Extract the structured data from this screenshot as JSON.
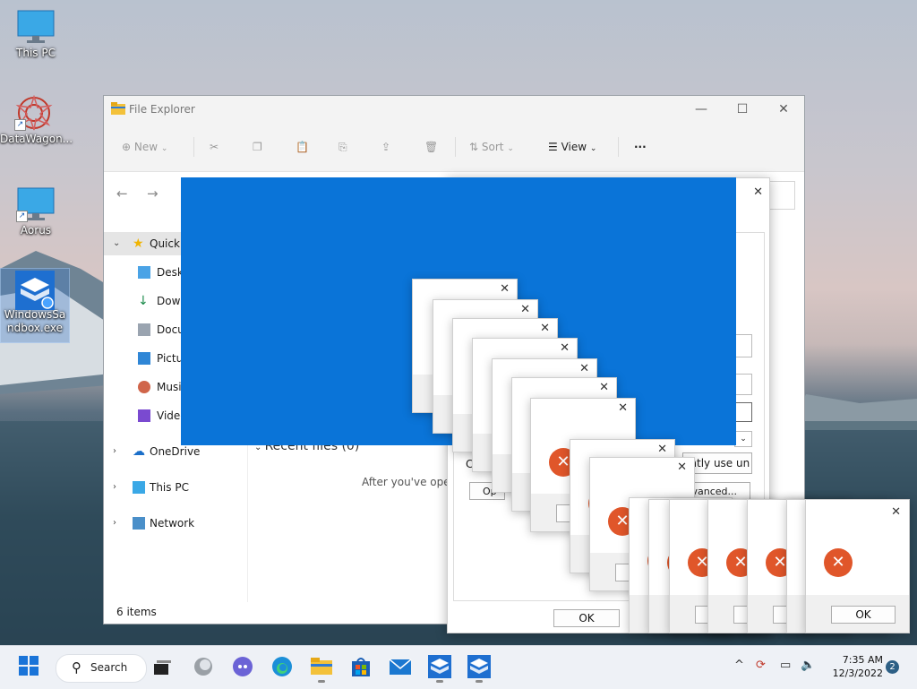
{
  "desktop": {
    "icons": [
      {
        "label": "This PC"
      },
      {
        "label": "DataWagon..."
      },
      {
        "label": "Aorus"
      },
      {
        "label": "WindowsSandbox.exe"
      }
    ]
  },
  "file_explorer": {
    "title": "File Explorer",
    "toolbar": {
      "new_label": "New",
      "sort_label": "Sort",
      "view_label": "View",
      "more_label": "···"
    },
    "nav": {
      "quick_access": "Quick a",
      "desktop": "Deskt",
      "downloads": "Down",
      "documents": "Docu",
      "pictures": "Pictu",
      "music": "Musi",
      "videos": "Video",
      "onedrive": "OneDrive",
      "this_pc": "This PC",
      "network": "Network"
    },
    "main": {
      "recent_files": "Recent files (0)",
      "empty_text": "After you've open"
    },
    "status": "6 items"
  },
  "bg_dialog": {
    "checkbox_text": "ently use un",
    "advanced_label": "vanced...",
    "open_label": "Op",
    "left_text": "C",
    "ok_label": "OK"
  },
  "error_dialogs": {
    "ok_label": "OK",
    "close_glyph": "✕",
    "error_glyph": "✕"
  },
  "taskbar": {
    "search_label": "Search",
    "time": "7:35 AM",
    "date": "12/3/2022",
    "notification_count": "2"
  },
  "colors": {
    "splash_blue": "#0a74d8",
    "error_orange": "#e0562a",
    "accent": "#0067c0"
  }
}
